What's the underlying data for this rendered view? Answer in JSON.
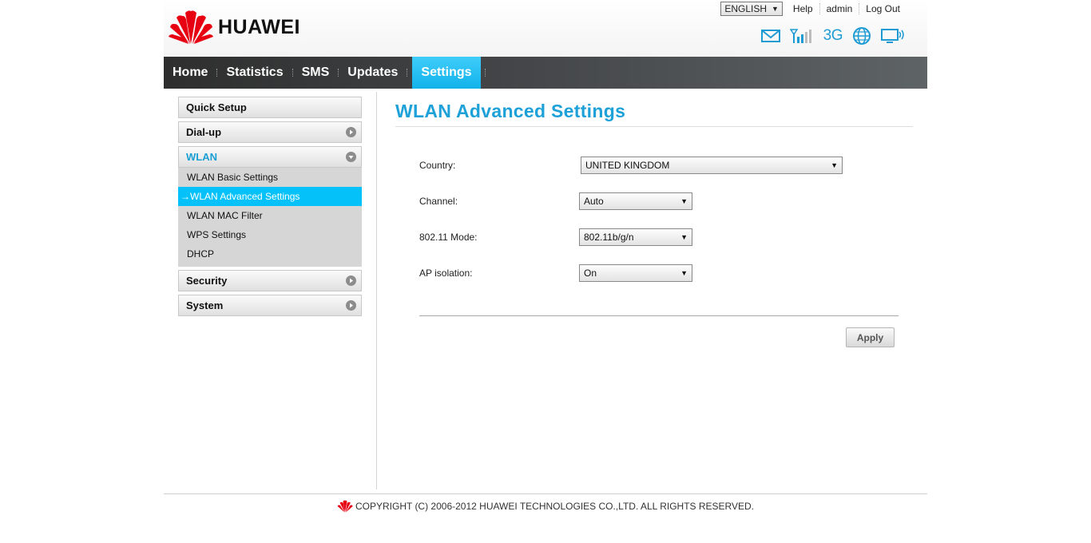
{
  "header": {
    "brand": "HUAWEI",
    "language": "ENGLISH",
    "links": [
      "Help",
      "admin",
      "Log Out"
    ],
    "status_icons": [
      "mail-icon",
      "signal-strength-icon",
      "network-type-3g",
      "internet-globe-icon",
      "wifi-device-icon"
    ],
    "network_type": "3G"
  },
  "nav": {
    "items": [
      "Home",
      "Statistics",
      "SMS",
      "Updates",
      "Settings"
    ],
    "active": "Settings"
  },
  "sidebar": {
    "quick_setup": "Quick Setup",
    "dialup": "Dial-up",
    "wlan": "WLAN",
    "wlan_items": [
      "WLAN Basic Settings",
      "→WLAN Advanced Settings",
      "WLAN MAC Filter",
      "WPS Settings",
      "DHCP"
    ],
    "security": "Security",
    "system": "System"
  },
  "main": {
    "title": "WLAN Advanced Settings",
    "country_label": "Country:",
    "country_value": "UNITED KINGDOM",
    "channel_label": "Channel:",
    "channel_value": "Auto",
    "mode_label": "802.11 Mode:",
    "mode_value": "802.11b/g/n",
    "ap_label": "AP isolation:",
    "ap_value": "On",
    "apply": "Apply"
  },
  "footer": {
    "copyright": "COPYRIGHT (C) 2006-2012 HUAWEI TECHNOLOGIES CO.,LTD. ALL RIGHTS RESERVED."
  },
  "colors": {
    "accent": "#1da1d8",
    "nav_active": "#11b2ea",
    "sidebar_active": "#05c1f9",
    "brand_red": "#e60012"
  }
}
